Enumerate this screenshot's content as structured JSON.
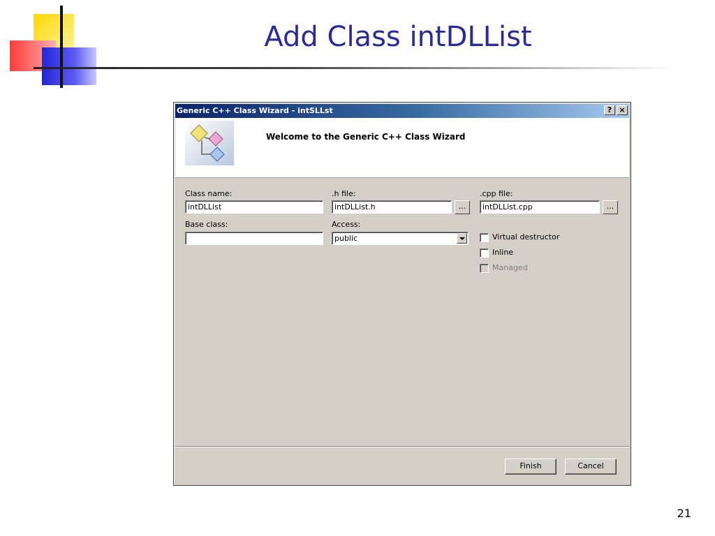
{
  "slide": {
    "title": "Add Class intDLList",
    "page_number": "21"
  },
  "dialog": {
    "title": "Generic C++ Class Wizard - intSLLst",
    "help_button": "?",
    "close_button": "×",
    "banner_text": "Welcome to the Generic C++ Class Wizard",
    "class_name": {
      "label": "Class name:",
      "value": "intDLList"
    },
    "h_file": {
      "label": ".h file:",
      "value": "intDLList.h",
      "browse": "..."
    },
    "cpp_file": {
      "label": ".cpp file:",
      "value": "intDLList.cpp",
      "browse": "..."
    },
    "base_class": {
      "label": "Base class:",
      "value": ""
    },
    "access": {
      "label": "Access:",
      "value": "public"
    },
    "checkboxes": [
      {
        "label": "Virtual destructor",
        "checked": false,
        "enabled": true
      },
      {
        "label": "Inline",
        "checked": false,
        "enabled": true
      },
      {
        "label": "Managed",
        "checked": false,
        "enabled": false
      }
    ],
    "finish_label": "Finish",
    "cancel_label": "Cancel"
  }
}
